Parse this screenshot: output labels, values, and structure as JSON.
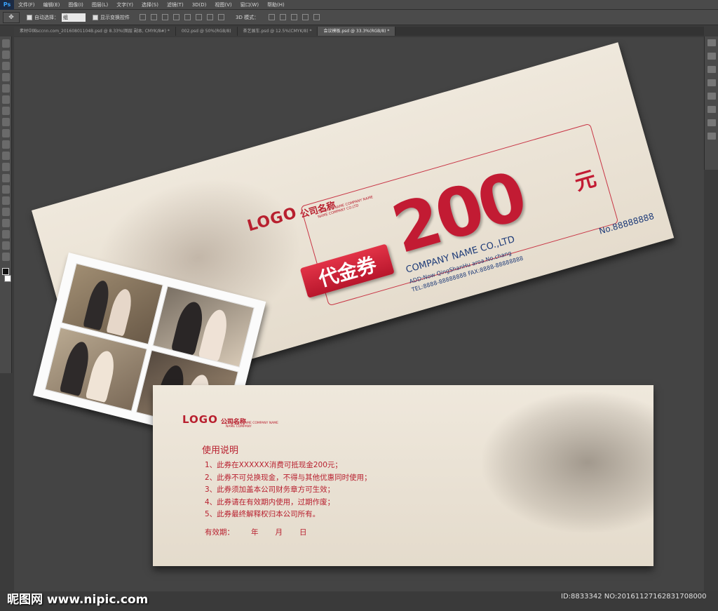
{
  "menubar": {
    "app": "Ps",
    "items": [
      "文件(F)",
      "编辑(E)",
      "图像(I)",
      "图层(L)",
      "文字(Y)",
      "选择(S)",
      "滤镜(T)",
      "3D(D)",
      "视图(V)",
      "窗口(W)",
      "帮助(H)"
    ]
  },
  "optbar": {
    "auto_select_label": "自动选择：",
    "auto_select_value": "组",
    "show_transform_label": "显示变换控件",
    "mode_3d_label": "3D 模式："
  },
  "tabs": [
    "素材中国sccnn.com_20160801104B.psd @ 8.33%(图层 副本, CMYK/8#) *",
    "002.psd @ 50%(RGB/8)",
    "茶艺展车.psd @ 12.5%(CMYK/8) *",
    "会议模板.psd @ 33.3%(RGB/8) *"
  ],
  "front": {
    "logo": "LOGO",
    "company_cn": "公司名称",
    "logo_sub_1": "COMPANY NAME COMPANY NAME",
    "logo_sub_2": "NAME COMPANY CO.LTD",
    "badge": "代金券",
    "amount": "200",
    "currency": "元",
    "company_name": "COMPANY NAME CO.,LTD",
    "address": "ADD:Now QingShanHu aroa.No.chang",
    "contact": "TEL:8888-88888888  FAX:8888-88888888",
    "serial": "No.88888888"
  },
  "back": {
    "logo": "LOGO",
    "company_cn": "公司名称",
    "logo_sub_1": "COMPANY NAME COMPANY NAME",
    "logo_sub_2": "NAME COMPANY",
    "rules_title": "使用说明",
    "rules": [
      "1、此券在XXXXXX消费可抵现金200元；",
      "2、此券不可兑换现金，不得与其他优惠同时使用；",
      "3、此券须加盖本公司财务章方可生效；",
      "4、此券请在有效期内使用，过期作废；",
      "5、此券最终解释权归本公司所有。"
    ],
    "validity_label": "有效期：",
    "validity_year": "年",
    "validity_month": "月",
    "validity_day": "日"
  },
  "watermark": {
    "site": "昵图网 www.nipic.com",
    "id": "ID:8833342 NO:20161127162831708000"
  },
  "colors": {
    "accent_red": "#c21b33",
    "navy": "#1e3b78",
    "paper": "#ece4d7",
    "ps_chrome": "#4a4a4a"
  }
}
